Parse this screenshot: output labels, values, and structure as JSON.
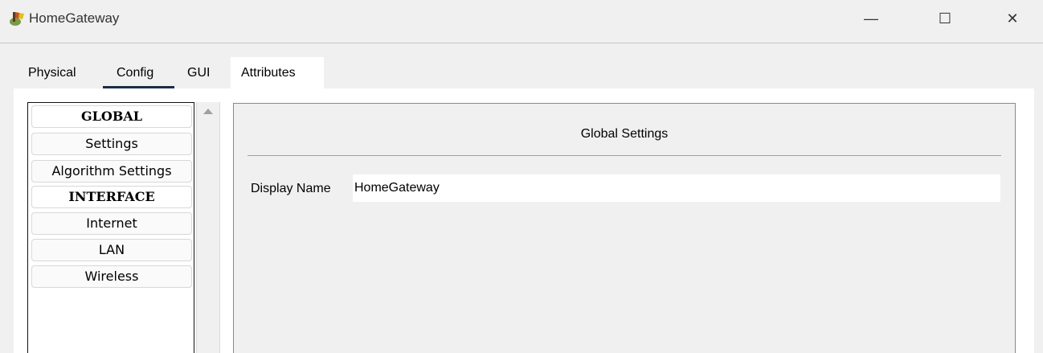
{
  "window": {
    "title": "HomeGateway",
    "icon": "router-icon",
    "controls": {
      "minimize": "—",
      "maximize": "☐",
      "close": "✕"
    }
  },
  "tabs": [
    {
      "label": "Physical"
    },
    {
      "label": "Config",
      "active": true
    },
    {
      "label": "GUI"
    },
    {
      "label": "Attributes"
    }
  ],
  "nav": {
    "items": [
      {
        "label": "GLOBAL",
        "header": true
      },
      {
        "label": "Settings"
      },
      {
        "label": "Algorithm Settings"
      },
      {
        "label": "INTERFACE",
        "header": true
      },
      {
        "label": "Internet"
      },
      {
        "label": "LAN"
      },
      {
        "label": "Wireless"
      }
    ]
  },
  "settings": {
    "title": "Global Settings",
    "display_name_label": "Display Name",
    "display_name_value": "HomeGateway"
  },
  "colors": {
    "accent_underline": "#1b2c4c",
    "background": "#f0f0f0"
  }
}
